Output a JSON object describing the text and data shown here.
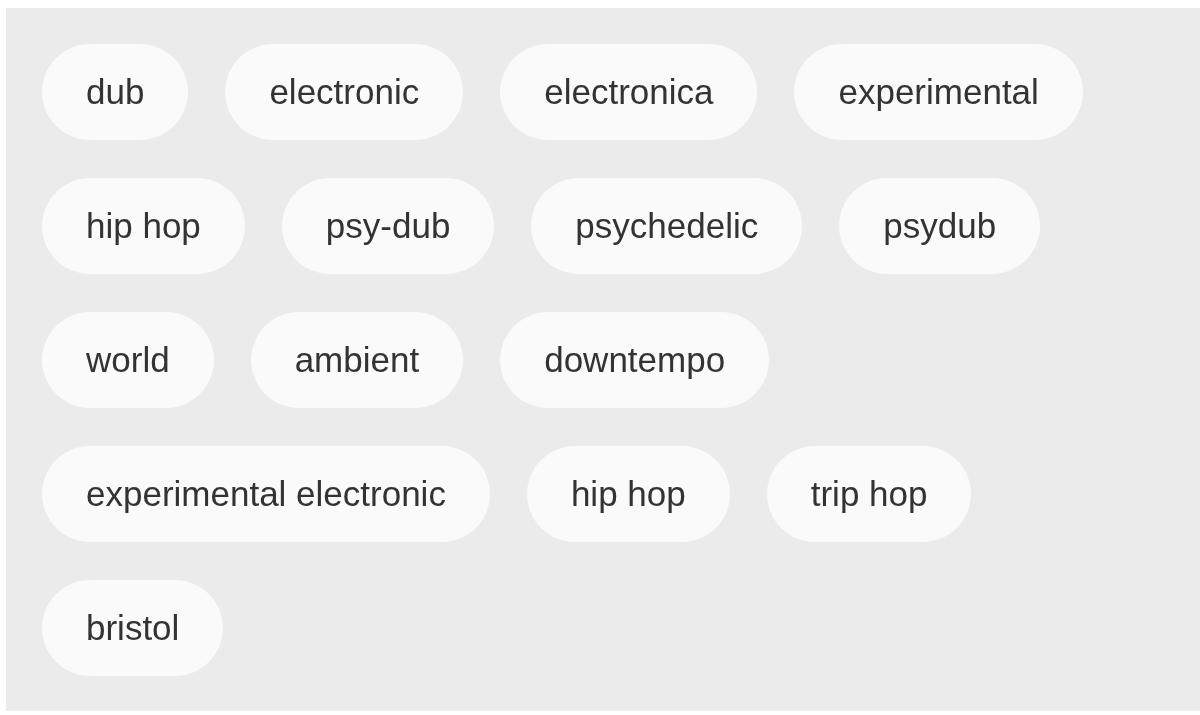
{
  "tag_rows": [
    [
      "dub",
      "electronic",
      "electronica",
      "experimental"
    ],
    [
      "hip hop",
      "psy-dub",
      "psychedelic",
      "psydub"
    ],
    [
      "world",
      "ambient",
      "downtempo"
    ],
    [
      "experimental electronic",
      "hip hop",
      "trip hop"
    ],
    [
      "bristol"
    ]
  ]
}
